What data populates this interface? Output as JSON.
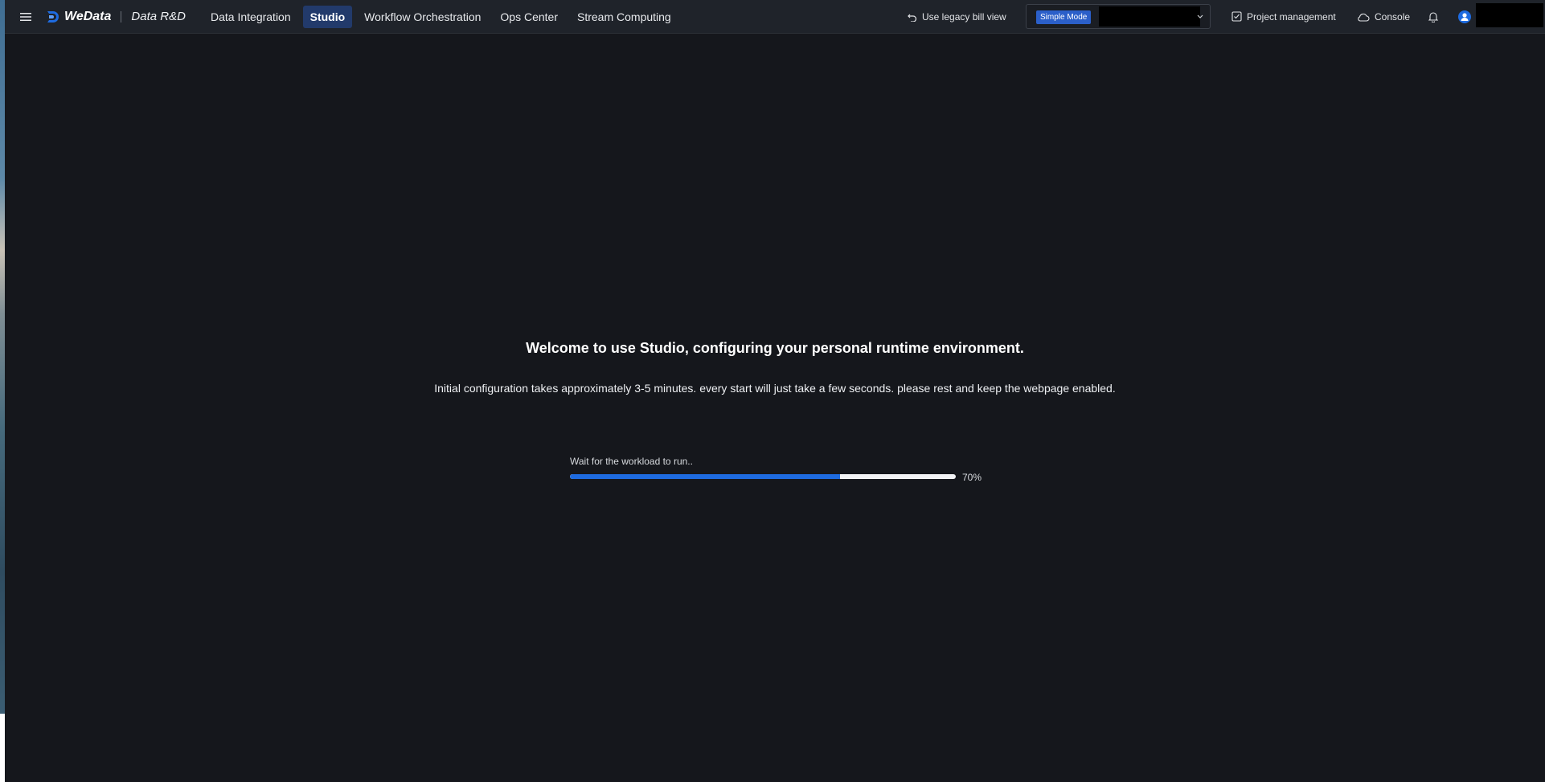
{
  "header": {
    "brand": "WeData",
    "product": "Data R&D",
    "nav": [
      {
        "label": "Data Integration"
      },
      {
        "label": "Studio"
      },
      {
        "label": "Workflow Orchestration"
      },
      {
        "label": "Ops Center"
      },
      {
        "label": "Stream Computing"
      }
    ],
    "active_nav": "Studio",
    "legacy_link": "Use legacy bill view",
    "mode_badge": "Simple Mode",
    "project_management": "Project management",
    "console": "Console"
  },
  "main": {
    "title": "Welcome to use Studio, configuring your personal runtime environment.",
    "subtitle": "Initial configuration takes approximately 3-5 minutes. every start will just take a few seconds. please rest and keep the webpage enabled.",
    "progress": {
      "label": "Wait for the workload to run..",
      "percent": 70,
      "percent_text": "70%"
    }
  },
  "colors": {
    "background": "#15171c",
    "topbar": "#1f232a",
    "accent": "#1e6be0",
    "active_nav_bg": "#223a6b"
  },
  "icons": [
    "menu-icon",
    "wedata-logo",
    "undo-icon",
    "chevron-down-icon",
    "checklist-icon",
    "cloud-icon",
    "bell-icon",
    "user-avatar-icon"
  ]
}
